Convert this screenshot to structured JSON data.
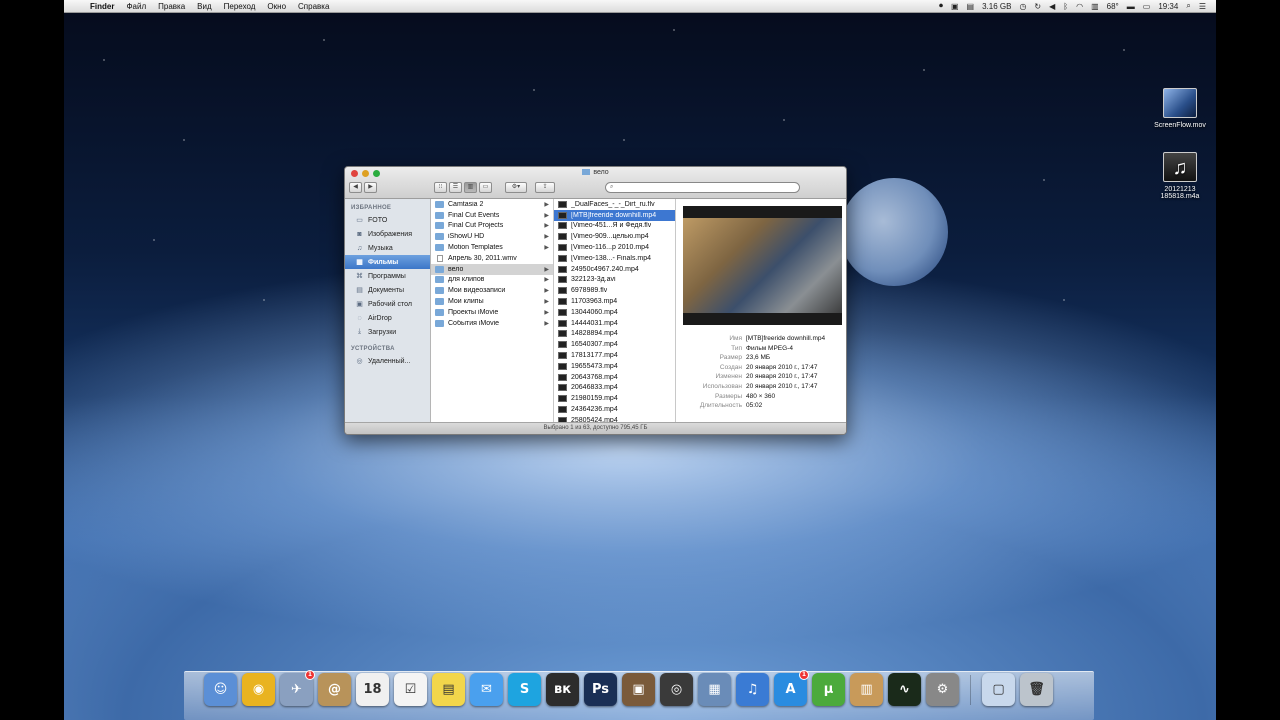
{
  "menubar": {
    "app": "Finder",
    "menus": [
      "Файл",
      "Правка",
      "Вид",
      "Переход",
      "Окно",
      "Справка"
    ],
    "memory": "3.16 GB",
    "temp": "68°",
    "time": "19:34"
  },
  "desktop_icons": [
    {
      "label": "ScreenFlow.mov",
      "kind": "mov"
    },
    {
      "label": "20121213 185818.m4a",
      "kind": "m4a"
    }
  ],
  "finder": {
    "title": "вело",
    "search_placeholder": "",
    "status": "Выбрано 1 из 63, доступно 795,45 ГБ",
    "sidebar": {
      "favorites_header": "ИЗБРАННОЕ",
      "favorites": [
        {
          "label": "FOTO",
          "icon": "folder-icon"
        },
        {
          "label": "Изображения",
          "icon": "camera-icon"
        },
        {
          "label": "Музыка",
          "icon": "music-note-icon"
        },
        {
          "label": "Фильмы",
          "icon": "film-icon",
          "selected": true
        },
        {
          "label": "Программы",
          "icon": "apps-icon"
        },
        {
          "label": "Документы",
          "icon": "document-icon"
        },
        {
          "label": "Рабочий стол",
          "icon": "desktop-icon"
        },
        {
          "label": "AirDrop",
          "icon": "airdrop-icon"
        },
        {
          "label": "Загрузки",
          "icon": "download-icon"
        }
      ],
      "devices_header": "УСТРОЙСТВА",
      "devices": [
        {
          "label": "Удаленный...",
          "icon": "disc-icon"
        }
      ]
    },
    "column1": [
      {
        "label": "Camtasia 2",
        "type": "folder",
        "arrow": true
      },
      {
        "label": "Final Cut Events",
        "type": "folder",
        "arrow": true
      },
      {
        "label": "Final Cut Projects",
        "type": "folder",
        "arrow": true
      },
      {
        "label": "iShowU HD",
        "type": "folder",
        "arrow": true
      },
      {
        "label": "Motion Templates",
        "type": "folder",
        "arrow": true
      },
      {
        "label": "Апрель 30, 2011.wmv",
        "type": "doc",
        "arrow": false
      },
      {
        "label": "вело",
        "type": "folder",
        "arrow": true,
        "selected": true
      },
      {
        "label": "для клипов",
        "type": "folder",
        "arrow": true
      },
      {
        "label": "Мои видеозаписи",
        "type": "folder",
        "arrow": true
      },
      {
        "label": "Мои клипы",
        "type": "folder",
        "arrow": true
      },
      {
        "label": "Проекты iMovie",
        "type": "folder",
        "arrow": true
      },
      {
        "label": "События iMovie",
        "type": "folder",
        "arrow": true
      }
    ],
    "column2": [
      {
        "label": "_DualFaces_-_-_Dirt_ru.flv",
        "selected": false
      },
      {
        "label": "[MTB]freeride downhill.mp4",
        "selected": true
      },
      {
        "label": "[Vimeo-451...Я и Федя.flv",
        "selected": false
      },
      {
        "label": "[Vimeo-909...целью.mp4",
        "selected": false
      },
      {
        "label": "[Vimeo-116...р 2010.mp4",
        "selected": false
      },
      {
        "label": "[Vimeo-138...- Finals.mp4",
        "selected": false
      },
      {
        "label": "24950c4967.240.mp4",
        "selected": false
      },
      {
        "label": "322123-3д.avi",
        "selected": false
      },
      {
        "label": "6978989.flv",
        "selected": false
      },
      {
        "label": "11703963.mp4",
        "selected": false
      },
      {
        "label": "13044060.mp4",
        "selected": false
      },
      {
        "label": "14444031.mp4",
        "selected": false
      },
      {
        "label": "14828894.mp4",
        "selected": false
      },
      {
        "label": "16540307.mp4",
        "selected": false
      },
      {
        "label": "17813177.mp4",
        "selected": false
      },
      {
        "label": "19655473.mp4",
        "selected": false
      },
      {
        "label": "20643768.mp4",
        "selected": false
      },
      {
        "label": "20646833.mp4",
        "selected": false
      },
      {
        "label": "21980159.mp4",
        "selected": false
      },
      {
        "label": "24364236.mp4",
        "selected": false
      },
      {
        "label": "25805424.mp4",
        "selected": false
      }
    ],
    "preview": {
      "info": [
        {
          "key": "Имя",
          "value": "[MTB]freeride downhill.mp4"
        },
        {
          "key": "Тип",
          "value": "Фильм MPEG-4"
        },
        {
          "key": "Размер",
          "value": "23,6 МБ"
        },
        {
          "key": "Создан",
          "value": "20 января 2010 г., 17:47"
        },
        {
          "key": "Изменен",
          "value": "20 января 2010 г., 17:47"
        },
        {
          "key": "Использован",
          "value": "20 января 2010 г., 17:47"
        },
        {
          "key": "Размеры",
          "value": "480 × 360"
        },
        {
          "key": "Длительность",
          "value": "05:02"
        }
      ]
    }
  },
  "dock": [
    {
      "name": "finder",
      "color": "#5b8fd6",
      "glyph": "☺"
    },
    {
      "name": "chrome",
      "color": "#e9b320",
      "glyph": "◉"
    },
    {
      "name": "xcode-tool",
      "color": "#8aa0c0",
      "glyph": "✈",
      "badge": "1"
    },
    {
      "name": "contacts",
      "color": "#b8935a",
      "glyph": "@"
    },
    {
      "name": "calendar",
      "color": "#f0f0f0",
      "glyph": "18"
    },
    {
      "name": "reminders",
      "color": "#f4f4f4",
      "glyph": "☑"
    },
    {
      "name": "stickies",
      "color": "#f2d64b",
      "glyph": "▤"
    },
    {
      "name": "messages",
      "color": "#4aa0ee",
      "glyph": "✉"
    },
    {
      "name": "skype",
      "color": "#1ea4e0",
      "glyph": "S"
    },
    {
      "name": "vk",
      "color": "#2c2c2c",
      "glyph": "вк"
    },
    {
      "name": "photoshop",
      "color": "#1a2f55",
      "glyph": "Ps"
    },
    {
      "name": "photo-app",
      "color": "#7a5a3a",
      "glyph": "▣"
    },
    {
      "name": "dvd",
      "color": "#3a3a3a",
      "glyph": "◎"
    },
    {
      "name": "preview",
      "color": "#6a8cb8",
      "glyph": "▦"
    },
    {
      "name": "itunes",
      "color": "#3a7bd4",
      "glyph": "♫"
    },
    {
      "name": "app-store",
      "color": "#2a8ce0",
      "glyph": "A",
      "badge": "1"
    },
    {
      "name": "utorrent",
      "color": "#4caa3c",
      "glyph": "μ"
    },
    {
      "name": "archive",
      "color": "#c89a5a",
      "glyph": "▥"
    },
    {
      "name": "activity-monitor",
      "color": "#1a2a1a",
      "glyph": "∿"
    },
    {
      "name": "system-prefs",
      "color": "#888888",
      "glyph": "⚙"
    }
  ],
  "dock_right": [
    {
      "name": "downloads-stack",
      "color": "#c8d8ec",
      "glyph": "▢"
    },
    {
      "name": "trash",
      "color": "#bcc4cc",
      "glyph": "🗑"
    }
  ]
}
